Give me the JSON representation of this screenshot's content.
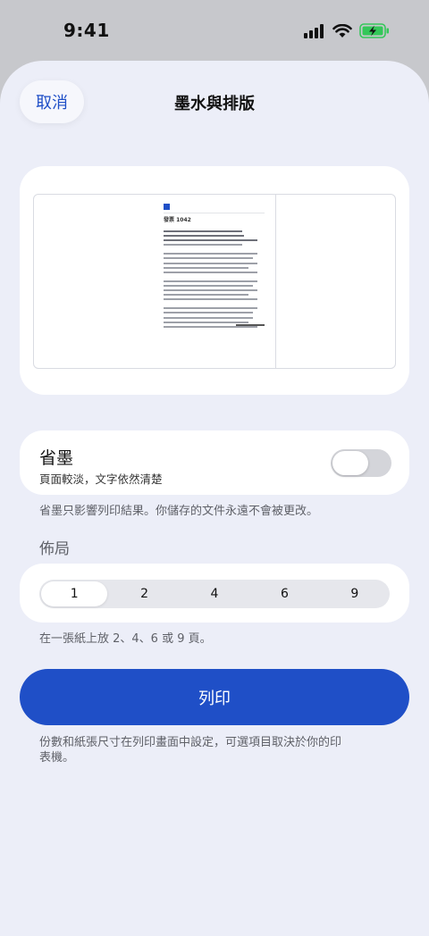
{
  "status_bar": {
    "time": "9:41",
    "icons": [
      "cellular-signal-icon",
      "wifi-icon",
      "battery-charging-icon"
    ],
    "battery_color": "#34c759"
  },
  "header": {
    "cancel_label": "取消",
    "title": "墨水與排版"
  },
  "preview": {
    "doc_title": "發票 1042"
  },
  "ink_saver": {
    "title": "省墨",
    "subtitle": "頁面較淡，文字依然清楚",
    "enabled": false,
    "note": "省墨只影響列印結果。你儲存的文件永遠不會被更改。"
  },
  "layout": {
    "section_label": "佈局",
    "options": [
      "1",
      "2",
      "4",
      "6",
      "9"
    ],
    "selected": "1",
    "note": "在一張紙上放 2、4、6 或 9 頁。"
  },
  "print": {
    "button_label": "列印",
    "footnote": "份數和紙張尺寸在列印畫面中設定，可選項目取決於你的印表機。"
  },
  "colors": {
    "accent": "#1f4fc7",
    "sheet_background": "#eceef8"
  }
}
